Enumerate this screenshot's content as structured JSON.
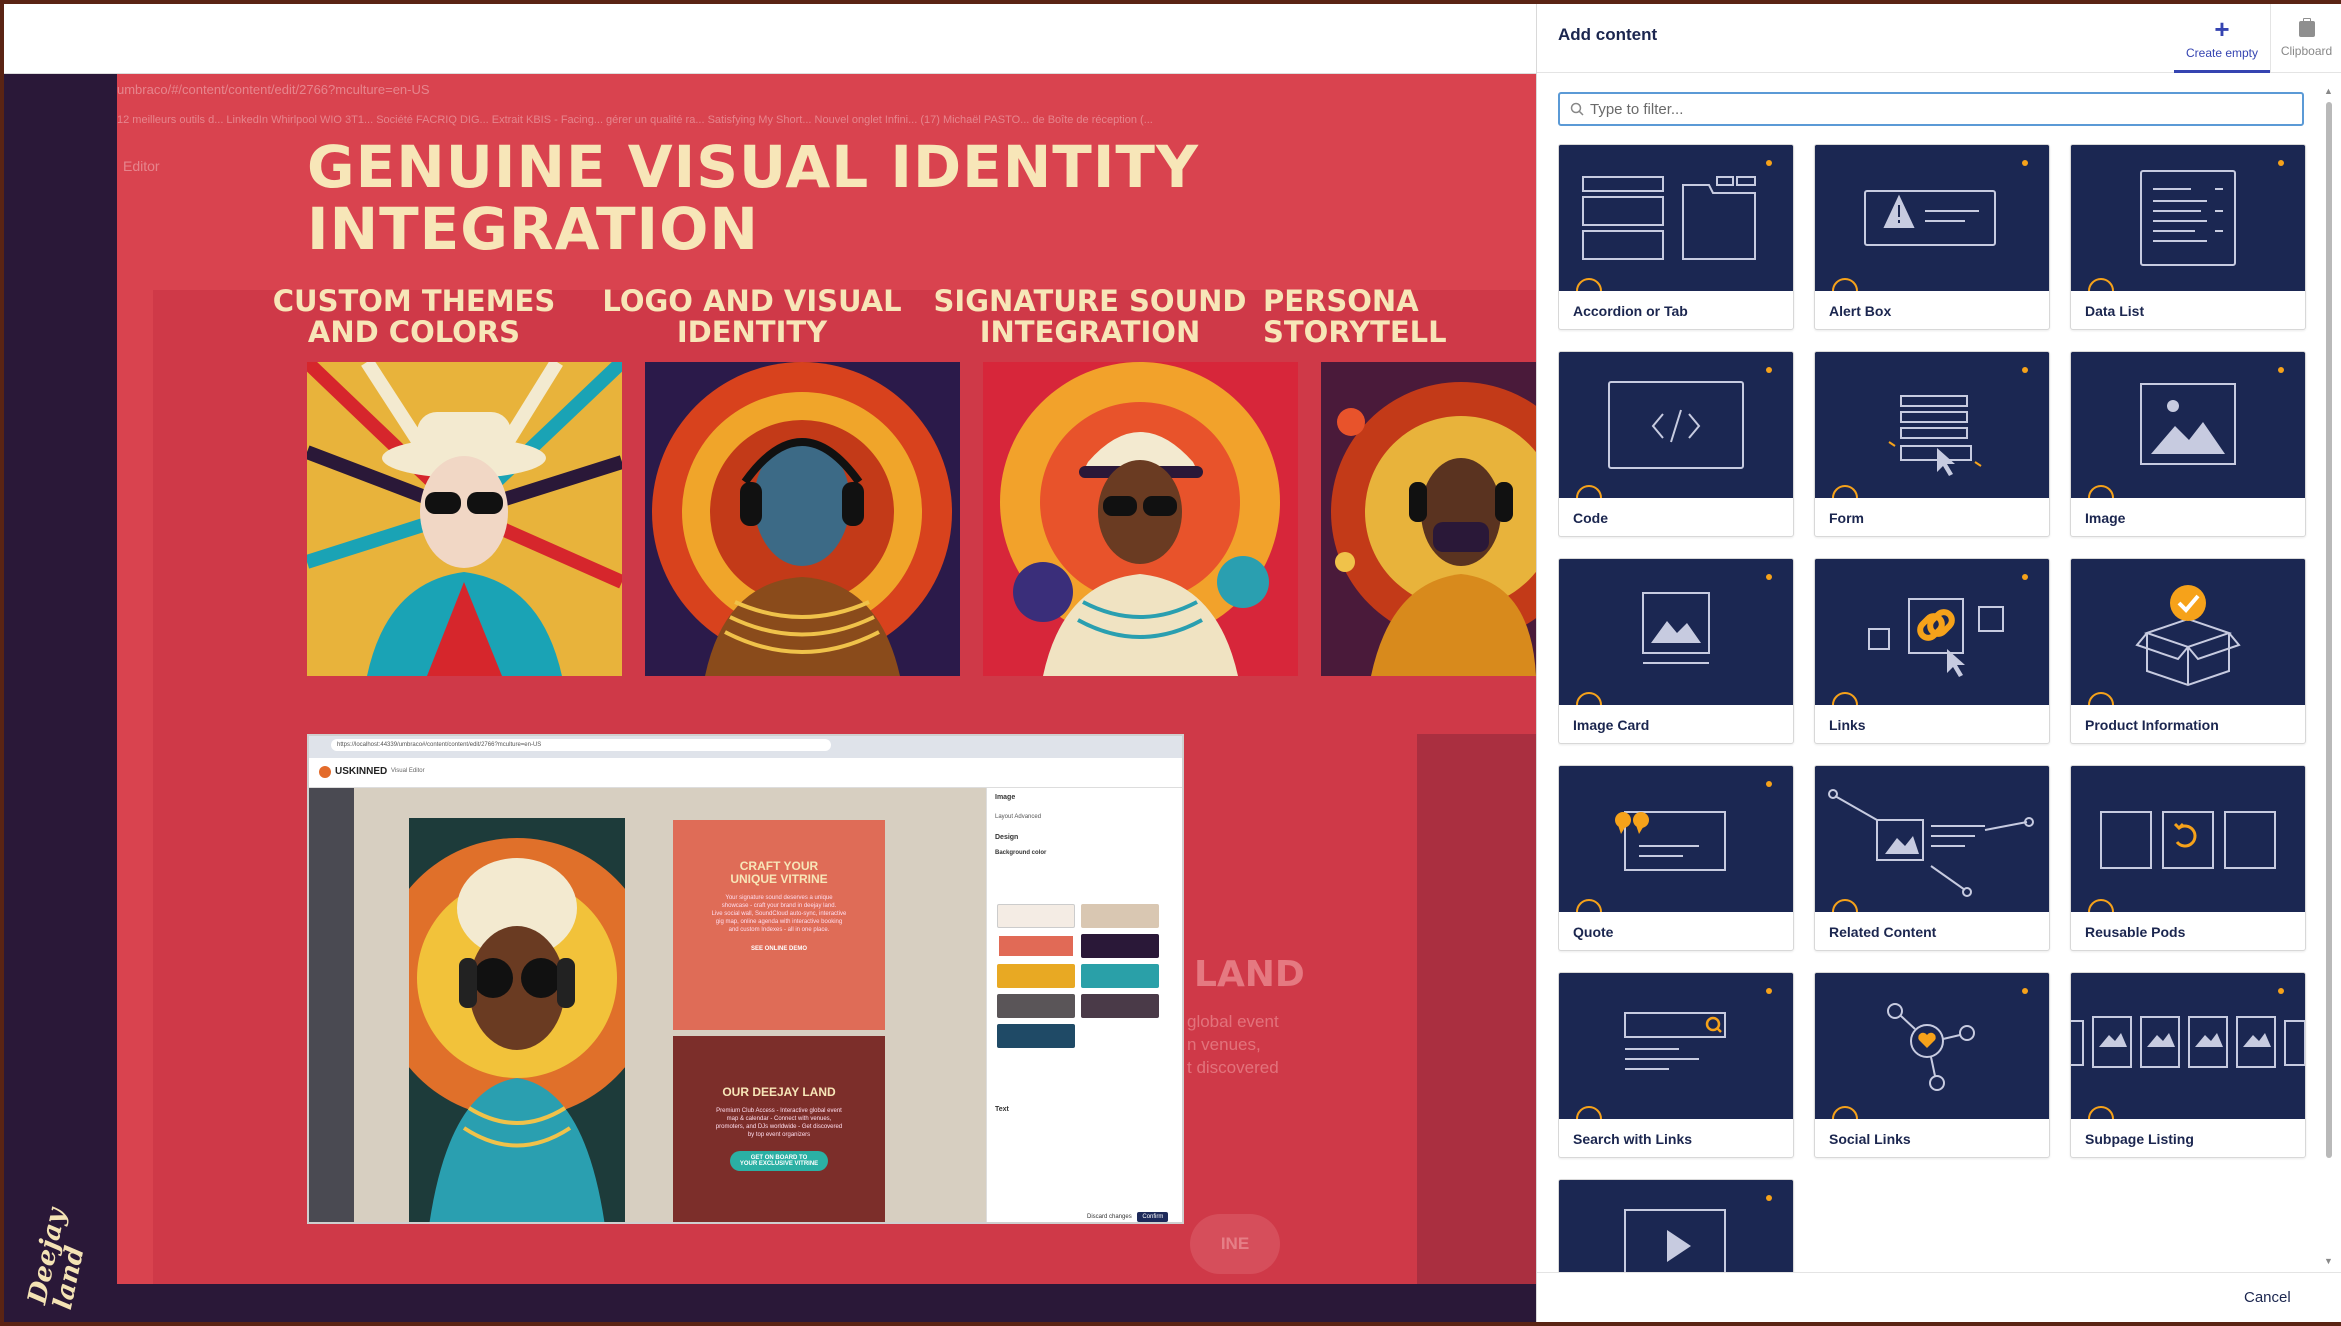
{
  "canvas": {
    "ghost_url": "umbraco/#/content/content/edit/2766?mculture=en-US",
    "ghost_bookmarks": "12 meilleurs outils d...   LinkedIn   Whirlpool WIO 3T1...   Société FACRIQ DIG...   Extrait KBIS - Facing...   gérer un qualité ra...   Satisfying My Short...   Nouvel onglet Infini...   (17) Michaël PASTO...   de   Boîte de réception (...",
    "ghost_editor": "Editor",
    "hero_title": "GENUINE VISUAL IDENTITY INTEGRATION",
    "features": [
      {
        "title": "CUSTOM THEMES AND COLORS"
      },
      {
        "title": "LOGO AND VISUAL IDENTITY"
      },
      {
        "title": "SIGNATURE SOUND INTEGRATION"
      },
      {
        "title": "PERSONA STORYTELL"
      }
    ],
    "ghost_land": "LAND",
    "ghost_lines": "global event\nn venues,\nt discovered",
    "ghost_cta": "INE"
  },
  "inner_shot": {
    "url": "https://localhost:44339/umbraco#/content/content/edit/2766?mculture=en-US",
    "brand": "USKINNED",
    "brand_sub": "Visual Editor",
    "card1": {
      "title": "CRAFT YOUR\nUNIQUE VITRINE",
      "text": "Your signature sound deserves a unique\nshowcase - craft your brand in deejay land.\nLive social wall, SoundCloud auto-sync, interactive\ngig map, online agenda with interactive booking\nand custom Indexes - all in one place.",
      "link": "SEE ONLINE DEMO"
    },
    "card2": {
      "title": "OUR DEEJAY LAND",
      "text": "Premium Club Access - Interactive global event\nmap & calendar - Connect with venues,\npromoters, and DJs worldwide - Get discovered\nby top event organizers",
      "button": "GET ON BOARD TO\nYOUR EXCLUSIVE VITRINE"
    },
    "panel": {
      "title": "Image",
      "tabs": "Layout      Advanced",
      "design": "Design",
      "bg_label": "Background color",
      "text_label": "Text",
      "discard": "Discard changes",
      "confirm": "Confirm"
    }
  },
  "panel": {
    "title": "Add content",
    "create_empty": "Create empty",
    "clipboard": "Clipboard",
    "filter_placeholder": "Type to filter...",
    "cancel": "Cancel",
    "colors": {
      "card_bg": "#1b2752",
      "accent": "#f6a21a",
      "link": "#3544b1"
    },
    "items": [
      {
        "label": "Accordion or Tab",
        "icon": "accordion-icon"
      },
      {
        "label": "Alert Box",
        "icon": "alert-icon"
      },
      {
        "label": "Data List",
        "icon": "data-list-icon"
      },
      {
        "label": "Code",
        "icon": "code-icon"
      },
      {
        "label": "Form",
        "icon": "form-icon"
      },
      {
        "label": "Image",
        "icon": "image-icon"
      },
      {
        "label": "Image Card",
        "icon": "image-card-icon"
      },
      {
        "label": "Links",
        "icon": "links-icon"
      },
      {
        "label": "Product Information",
        "icon": "product-icon"
      },
      {
        "label": "Quote",
        "icon": "quote-icon"
      },
      {
        "label": "Related Content",
        "icon": "related-content-icon"
      },
      {
        "label": "Reusable Pods",
        "icon": "reusable-pods-icon"
      },
      {
        "label": "Search with Links",
        "icon": "search-links-icon"
      },
      {
        "label": "Social Links",
        "icon": "social-links-icon"
      },
      {
        "label": "Subpage Listing",
        "icon": "subpage-listing-icon"
      },
      {
        "label": "",
        "icon": "video-icon"
      }
    ]
  },
  "logo_text": "Deejay land"
}
